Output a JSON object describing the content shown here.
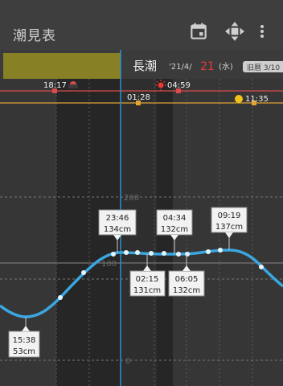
{
  "app": {
    "title": "潮見表",
    "icons": [
      "calendar-icon",
      "move-arrows-icon",
      "more-vert-icon"
    ]
  },
  "header": {
    "tide_type": "長潮",
    "date_prefix": "'21/4/",
    "day": "21",
    "weekday": "(水)",
    "badge": "旧暦 3/10"
  },
  "sun": {
    "sunset_time": "18:17",
    "sunrise_time": "04:59"
  },
  "moon": {
    "moonset_time": "01:28",
    "moonrise_time": "11:35"
  },
  "axis": {
    "y_top": "200",
    "y_mid": "100",
    "y_zero": "0"
  },
  "colors": {
    "curve": "#3aa7e0",
    "sun_line": "#d94c4c",
    "moon_line": "#e1a534",
    "cursor": "#2d8fd0",
    "highlight": "#888024",
    "today": "#e53935"
  },
  "tide_labels": [
    {
      "time": "15:38",
      "height": "53cm"
    },
    {
      "time": "23:46",
      "height": "134cm"
    },
    {
      "time": "02:15",
      "height": "131cm"
    },
    {
      "time": "04:34",
      "height": "132cm"
    },
    {
      "time": "06:05",
      "height": "132cm"
    },
    {
      "time": "09:19",
      "height": "137cm"
    }
  ]
}
